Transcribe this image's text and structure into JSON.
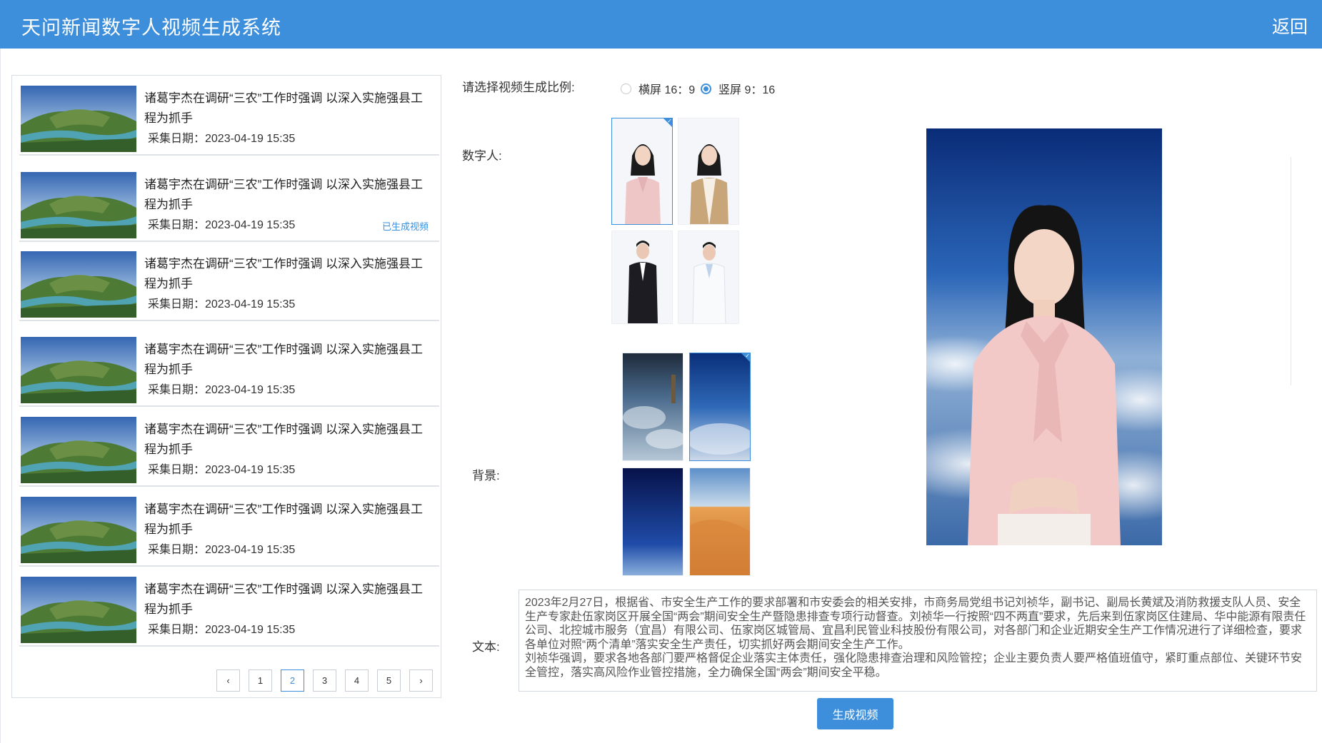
{
  "app": {
    "title": "天问新闻数字人视频生成系统",
    "back_label": "返回"
  },
  "news_list": [
    {
      "title": "诸葛宇杰在调研“三农”工作时强调 以深入实施强县工程为抓手",
      "date_label": "采集日期：2023-04-19 15:35",
      "status": ""
    },
    {
      "title": "诸葛宇杰在调研“三农”工作时强调 以深入实施强县工程为抓手",
      "date_label": "采集日期：2023-04-19 15:35",
      "status": "已生成视频"
    },
    {
      "title": "诸葛宇杰在调研“三农”工作时强调 以深入实施强县工程为抓手",
      "date_label": "采集日期：2023-04-19 15:35",
      "status": ""
    },
    {
      "title": "诸葛宇杰在调研“三农”工作时强调 以深入实施强县工程为抓手",
      "date_label": "采集日期：2023-04-19 15:35",
      "status": ""
    },
    {
      "title": "诸葛宇杰在调研“三农”工作时强调 以深入实施强县工程为抓手",
      "date_label": "采集日期：2023-04-19 15:35",
      "status": ""
    },
    {
      "title": "诸葛宇杰在调研“三农”工作时强调 以深入实施强县工程为抓手",
      "date_label": "采集日期：2023-04-19 15:35",
      "status": ""
    },
    {
      "title": "诸葛宇杰在调研“三农”工作时强调 以深入实施强县工程为抓手",
      "date_label": "采集日期：2023-04-19 15:35",
      "status": ""
    }
  ],
  "pagination": {
    "prev": "‹",
    "pages": [
      "1",
      "2",
      "3",
      "4",
      "5"
    ],
    "current": "2",
    "next": "›"
  },
  "form": {
    "ratio_label": "请选择视频生成比例:",
    "ratio_options": [
      "横屏 16：9",
      "竖屏 9：16"
    ],
    "ratio_selected": "竖屏 9：16",
    "avatar_label": "数字人:",
    "background_label": "背景:",
    "text_label": "文本:",
    "text_value": "2023年2月27日，根据省、市安全生产工作的要求部署和市安委会的相关安排，市商务局党组书记刘祯华，副书记、副局长黄斌及消防救援支队人员、安全生产专家赴伍家岗区开展全国“两会”期间安全生产暨隐患排查专项行动督查。刘祯华一行按照“四不两直”要求，先后来到伍家岗区住建局、华中能源有限责任公司、北控城市服务（宜昌）有限公司、伍家岗区城管局、宜昌利民管业科技股份有限公司，对各部门和企业近期安全生产工作情况进行了详细检查，要求各单位对照“两个清单”落实安全生产责任，切实抓好两会期间安全生产工作。\n刘祯华强调，要求各地各部门要严格督促企业落实主体责任，强化隐患排查治理和风险管控；企业主要负责人要严格值班值守，紧盯重点部位、关键环节安全管控，落实高风险作业管控措施，全力确保全国“两会”期间安全平稳。",
    "generate_label": "生成视频"
  },
  "colors": {
    "header": "#3d8fdc",
    "accent": "#3d8fdc"
  }
}
